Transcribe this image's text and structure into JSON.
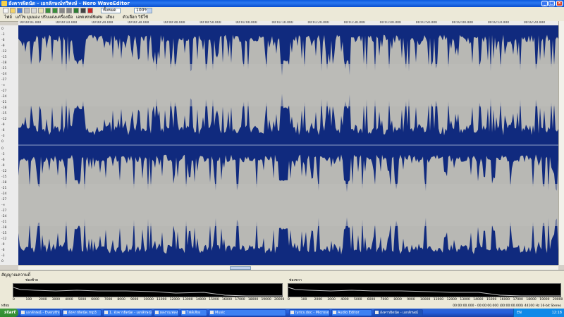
{
  "window": {
    "title": "อังคารผิดนัด - เอกลักษณ์ทวีพงษ์ - Nero WaveEditor"
  },
  "toolbar": {
    "zoom_value": "ทั้งหมด",
    "percent_value": "100%",
    "icon_names": [
      "new-icon",
      "open-icon",
      "save-icon",
      "cut-icon",
      "copy-icon",
      "paste-icon",
      "undo-icon",
      "redo-icon",
      "zoom-in-icon",
      "zoom-out-icon",
      "play-icon",
      "stop-icon",
      "record-icon"
    ]
  },
  "menu": {
    "items": [
      "ไฟล์",
      "แก้ไข",
      "มุมมอง",
      "ปรับแต่ง",
      "เครื่องมือ",
      "เอฟเฟกต์พิเศษ",
      "เสียง",
      "ตัวเลือก",
      "วิธีใช้"
    ]
  },
  "ruler": {
    "ticks": [
      "00:00:01.000",
      "00:00:10.000",
      "00:00:20.000",
      "00:00:30.000",
      "00:00:40.000",
      "00:00:50.000",
      "00:01:00.000",
      "00:01:10.000",
      "00:01:20.000",
      "00:01:30.000",
      "00:01:40.000",
      "00:01:50.000",
      "00:02:00.000",
      "00:02:10.000",
      "00:02:20.000"
    ]
  },
  "db_scale": {
    "labels": [
      "0",
      "-3",
      "-6",
      "-9",
      "-12",
      "-15",
      "-18",
      "-21",
      "-24",
      "-27",
      "-∞",
      "-27",
      "-24",
      "-21",
      "-18",
      "-15",
      "-12",
      "-9",
      "-6",
      "-3",
      "0"
    ]
  },
  "spectrum": {
    "header": "สัญญาณความถี่",
    "left_title": "ช่องซ้าย",
    "right_title": "ช่องขวา",
    "axis": [
      "0",
      "100",
      "2000",
      "3000",
      "4000",
      "5000",
      "6000",
      "7000",
      "8000",
      "9000",
      "10000",
      "11000",
      "12000",
      "13000",
      "14000",
      "15000",
      "16000",
      "17000",
      "18000",
      "19000",
      "20000"
    ]
  },
  "status": {
    "left": "พร้อม",
    "right": "00:00:00.000 - 00:00:00.000 (00:00:00.000)  44100 Hz 16-bit Stereo"
  },
  "taskbar": {
    "start_label": "start",
    "tasks": [
      {
        "label": "เอกลักษณ์ - Everything",
        "active": false
      },
      {
        "label": "อังคารผิดนัด.mp3",
        "active": false
      },
      {
        "label": "1. อังคารผิดนัด - เอกลักษณ์",
        "active": false
      },
      {
        "label": "ผลงานเพลง",
        "active": false
      },
      {
        "label": "ไฟล์เสียง",
        "active": false
      },
      {
        "label": "Music",
        "active": false
      },
      {
        "label": "lyrics.doc - Microsoft W...",
        "active": false
      },
      {
        "label": "Audio Editor",
        "active": false
      },
      {
        "label": "อังคารผิดนัด - เอกลักษณ์",
        "active": true
      }
    ],
    "tray_lang": "EN",
    "clock": "12:18"
  },
  "colors": {
    "wave_bg": "#102a7e",
    "wave_fg": "#b8b8b4"
  }
}
